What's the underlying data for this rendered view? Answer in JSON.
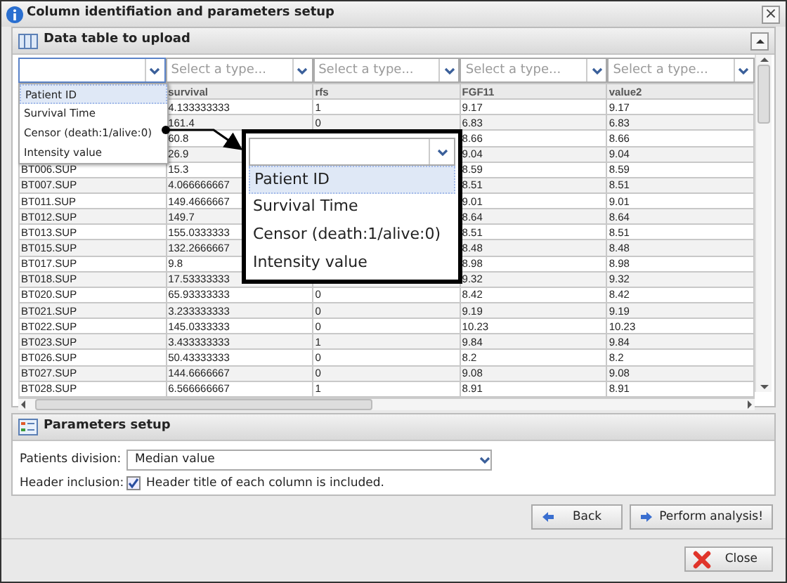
{
  "window": {
    "title": "Column identifiation and parameters setup",
    "close": "×"
  },
  "data_panel": {
    "title": "Data table to upload",
    "type_selects": [
      {
        "open": true
      },
      {
        "placeholder": "Select a type...",
        "open": false
      },
      {
        "placeholder": "Select a type...",
        "open": false
      },
      {
        "placeholder": "Select a type...",
        "open": false
      },
      {
        "placeholder": "Select a type...",
        "open": false
      }
    ],
    "dropdown": {
      "options": [
        {
          "label": "Patient ID",
          "selected": true
        },
        {
          "label": "Survival Time",
          "selected": false
        },
        {
          "label": "Censor (death:1/alive:0)",
          "selected": false
        },
        {
          "label": "Intensity value",
          "selected": false
        }
      ]
    },
    "table": {
      "columns": [
        null,
        "survival",
        "rfs",
        "FGF11",
        "value2"
      ],
      "rows": [
        [
          null,
          "4.133333333",
          "1",
          "9.17",
          "9.17"
        ],
        [
          null,
          "161.4",
          "0",
          "6.83",
          "6.83"
        ],
        [
          null,
          "60.8",
          null,
          "8.66",
          "8.66"
        ],
        [
          null,
          "26.9",
          null,
          "9.04",
          "9.04"
        ],
        [
          "BT006.SUP",
          "15.3",
          null,
          "8.59",
          "8.59"
        ],
        [
          "BT007.SUP",
          "4.066666667",
          null,
          "8.51",
          "8.51"
        ],
        [
          "BT011.SUP",
          "149.4666667",
          null,
          "9.01",
          "9.01"
        ],
        [
          "BT012.SUP",
          "149.7",
          null,
          "8.64",
          "8.64"
        ],
        [
          "BT013.SUP",
          "155.0333333",
          null,
          "8.51",
          "8.51"
        ],
        [
          "BT015.SUP",
          "132.2666667",
          null,
          "8.48",
          "8.48"
        ],
        [
          "BT017.SUP",
          "9.8",
          null,
          "8.98",
          "8.98"
        ],
        [
          "BT018.SUP",
          "17.53333333",
          null,
          "9.32",
          "9.32"
        ],
        [
          "BT020.SUP",
          "65.93333333",
          "0",
          "8.42",
          "8.42"
        ],
        [
          "BT021.SUP",
          "3.233333333",
          "0",
          "9.19",
          "9.19"
        ],
        [
          "BT022.SUP",
          "145.0333333",
          "0",
          "10.23",
          "10.23"
        ],
        [
          "BT023.SUP",
          "3.433333333",
          "1",
          "9.84",
          "9.84"
        ],
        [
          "BT026.SUP",
          "50.43333333",
          "0",
          "8.2",
          "8.2"
        ],
        [
          "BT027.SUP",
          "144.6666667",
          "0",
          "9.08",
          "9.08"
        ],
        [
          "BT028.SUP",
          "6.566666667",
          "1",
          "8.91",
          "8.91"
        ]
      ]
    },
    "callout": {
      "options": [
        {
          "label": "Patient ID",
          "selected": true
        },
        {
          "label": "Survival Time",
          "selected": false
        },
        {
          "label": "Censor (death:1/alive:0)",
          "selected": false
        },
        {
          "label": "Intensity value",
          "selected": false
        }
      ]
    }
  },
  "params_panel": {
    "title": "Parameters setup",
    "patients_division": {
      "label": "Patients division:",
      "value": "Median value"
    },
    "header_inclusion": {
      "label": "Header inclusion:",
      "checked": true,
      "text": "Header title of each column is included."
    }
  },
  "buttons": [
    {
      "label": "Back",
      "kind": "back"
    },
    {
      "label": "Perform analysis!",
      "kind": "forward"
    }
  ],
  "footer": {
    "close": "Close"
  }
}
